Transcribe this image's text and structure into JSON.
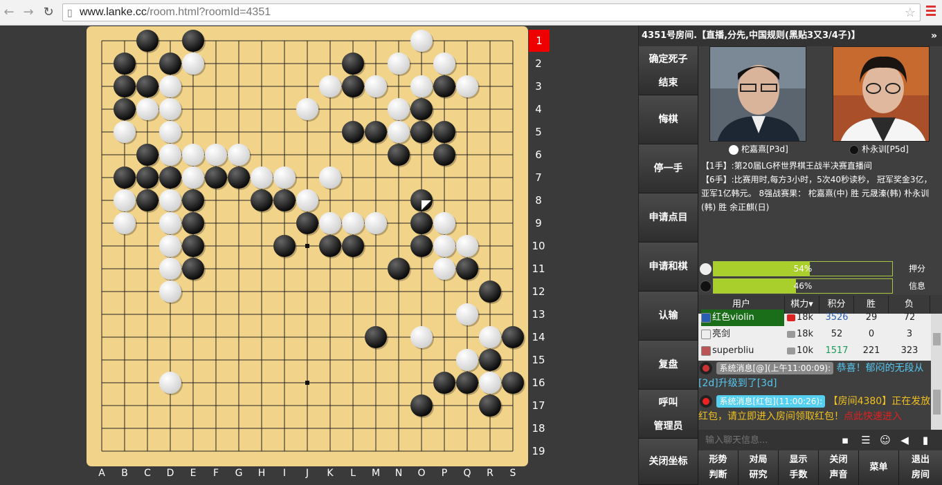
{
  "browser": {
    "url_host": "www.lanke.cc",
    "url_path": "/room.html?roomId=4351"
  },
  "board": {
    "size": 19,
    "columns": [
      "A",
      "B",
      "C",
      "D",
      "E",
      "F",
      "G",
      "H",
      "I",
      "J",
      "K",
      "L",
      "M",
      "N",
      "O",
      "P",
      "Q",
      "R",
      "S"
    ],
    "rows": [
      "1",
      "2",
      "3",
      "4",
      "5",
      "6",
      "7",
      "8",
      "9",
      "10",
      "11",
      "12",
      "13",
      "14",
      "15",
      "16",
      "17",
      "18",
      "19"
    ],
    "highlighted_row": "1",
    "stones": [
      {
        "c": "black",
        "x": 3,
        "y": 1
      },
      {
        "c": "black",
        "x": 5,
        "y": 1
      },
      {
        "c": "white",
        "x": 15,
        "y": 1
      },
      {
        "c": "black",
        "x": 2,
        "y": 2
      },
      {
        "c": "black",
        "x": 4,
        "y": 2
      },
      {
        "c": "white",
        "x": 5,
        "y": 2
      },
      {
        "c": "black",
        "x": 12,
        "y": 2
      },
      {
        "c": "white",
        "x": 14,
        "y": 2
      },
      {
        "c": "white",
        "x": 16,
        "y": 2
      },
      {
        "c": "black",
        "x": 2,
        "y": 3
      },
      {
        "c": "black",
        "x": 3,
        "y": 3
      },
      {
        "c": "white",
        "x": 4,
        "y": 3
      },
      {
        "c": "white",
        "x": 11,
        "y": 3
      },
      {
        "c": "black",
        "x": 12,
        "y": 3
      },
      {
        "c": "white",
        "x": 13,
        "y": 3
      },
      {
        "c": "white",
        "x": 15,
        "y": 3
      },
      {
        "c": "black",
        "x": 16,
        "y": 3
      },
      {
        "c": "white",
        "x": 17,
        "y": 3
      },
      {
        "c": "black",
        "x": 2,
        "y": 4
      },
      {
        "c": "white",
        "x": 3,
        "y": 4
      },
      {
        "c": "white",
        "x": 4,
        "y": 4
      },
      {
        "c": "white",
        "x": 10,
        "y": 4
      },
      {
        "c": "white",
        "x": 14,
        "y": 4
      },
      {
        "c": "black",
        "x": 15,
        "y": 4
      },
      {
        "c": "white",
        "x": 2,
        "y": 5
      },
      {
        "c": "white",
        "x": 4,
        "y": 5
      },
      {
        "c": "black",
        "x": 12,
        "y": 5
      },
      {
        "c": "black",
        "x": 13,
        "y": 5
      },
      {
        "c": "white",
        "x": 14,
        "y": 5
      },
      {
        "c": "black",
        "x": 15,
        "y": 5
      },
      {
        "c": "black",
        "x": 16,
        "y": 5
      },
      {
        "c": "black",
        "x": 3,
        "y": 6
      },
      {
        "c": "white",
        "x": 4,
        "y": 6
      },
      {
        "c": "white",
        "x": 5,
        "y": 6
      },
      {
        "c": "white",
        "x": 6,
        "y": 6
      },
      {
        "c": "white",
        "x": 7,
        "y": 6
      },
      {
        "c": "black",
        "x": 14,
        "y": 6
      },
      {
        "c": "black",
        "x": 16,
        "y": 6
      },
      {
        "c": "black",
        "x": 2,
        "y": 7
      },
      {
        "c": "black",
        "x": 3,
        "y": 7
      },
      {
        "c": "black",
        "x": 4,
        "y": 7
      },
      {
        "c": "white",
        "x": 5,
        "y": 7
      },
      {
        "c": "black",
        "x": 6,
        "y": 7
      },
      {
        "c": "black",
        "x": 7,
        "y": 7
      },
      {
        "c": "white",
        "x": 8,
        "y": 7
      },
      {
        "c": "white",
        "x": 9,
        "y": 7
      },
      {
        "c": "white",
        "x": 11,
        "y": 7
      },
      {
        "c": "white",
        "x": 2,
        "y": 8
      },
      {
        "c": "black",
        "x": 3,
        "y": 8
      },
      {
        "c": "white",
        "x": 4,
        "y": 8
      },
      {
        "c": "black",
        "x": 5,
        "y": 8
      },
      {
        "c": "black",
        "x": 8,
        "y": 8
      },
      {
        "c": "black",
        "x": 9,
        "y": 8
      },
      {
        "c": "white",
        "x": 10,
        "y": 8
      },
      {
        "c": "black",
        "x": 15,
        "y": 8,
        "last": true
      },
      {
        "c": "white",
        "x": 2,
        "y": 9
      },
      {
        "c": "white",
        "x": 4,
        "y": 9
      },
      {
        "c": "black",
        "x": 5,
        "y": 9
      },
      {
        "c": "black",
        "x": 10,
        "y": 9
      },
      {
        "c": "white",
        "x": 11,
        "y": 9
      },
      {
        "c": "white",
        "x": 12,
        "y": 9
      },
      {
        "c": "white",
        "x": 13,
        "y": 9
      },
      {
        "c": "black",
        "x": 15,
        "y": 9
      },
      {
        "c": "white",
        "x": 16,
        "y": 9
      },
      {
        "c": "white",
        "x": 4,
        "y": 10
      },
      {
        "c": "black",
        "x": 5,
        "y": 10
      },
      {
        "c": "black",
        "x": 9,
        "y": 10
      },
      {
        "c": "black",
        "x": 11,
        "y": 10
      },
      {
        "c": "black",
        "x": 12,
        "y": 10
      },
      {
        "c": "black",
        "x": 15,
        "y": 10
      },
      {
        "c": "white",
        "x": 16,
        "y": 10
      },
      {
        "c": "white",
        "x": 17,
        "y": 10
      },
      {
        "c": "white",
        "x": 4,
        "y": 11
      },
      {
        "c": "black",
        "x": 5,
        "y": 11
      },
      {
        "c": "black",
        "x": 14,
        "y": 11
      },
      {
        "c": "white",
        "x": 16,
        "y": 11
      },
      {
        "c": "black",
        "x": 17,
        "y": 11
      },
      {
        "c": "white",
        "x": 4,
        "y": 12
      },
      {
        "c": "black",
        "x": 18,
        "y": 12
      },
      {
        "c": "white",
        "x": 17,
        "y": 13
      },
      {
        "c": "black",
        "x": 13,
        "y": 14
      },
      {
        "c": "white",
        "x": 15,
        "y": 14
      },
      {
        "c": "white",
        "x": 18,
        "y": 14
      },
      {
        "c": "black",
        "x": 19,
        "y": 14
      },
      {
        "c": "white",
        "x": 17,
        "y": 15
      },
      {
        "c": "black",
        "x": 18,
        "y": 15
      },
      {
        "c": "white",
        "x": 4,
        "y": 16
      },
      {
        "c": "black",
        "x": 16,
        "y": 16
      },
      {
        "c": "black",
        "x": 17,
        "y": 16
      },
      {
        "c": "white",
        "x": 18,
        "y": 16
      },
      {
        "c": "black",
        "x": 19,
        "y": 16
      },
      {
        "c": "black",
        "x": 15,
        "y": 17
      },
      {
        "c": "black",
        "x": 18,
        "y": 17
      }
    ],
    "star_points": [
      {
        "x": 10,
        "y": 10
      },
      {
        "x": 10,
        "y": 16
      }
    ]
  },
  "room": {
    "title": "4351号房间.【直播,分先,中国规则(黑贴3又3/4子)】",
    "expand": "»"
  },
  "side_buttons": [
    {
      "lines": [
        "确定死子",
        "结束"
      ]
    },
    {
      "lines": [
        "悔棋"
      ]
    },
    {
      "lines": [
        "停一手"
      ]
    },
    {
      "lines": [
        "申请点目"
      ]
    },
    {
      "lines": [
        "申请和棋"
      ]
    },
    {
      "lines": [
        "认输"
      ]
    },
    {
      "lines": [
        "复盘"
      ]
    },
    {
      "lines": [
        "呼叫",
        "管理员"
      ]
    },
    {
      "lines": [
        "关闭坐标"
      ]
    }
  ],
  "players": {
    "white": {
      "name": "柁嘉熹[P3d]"
    },
    "black": {
      "name": "朴永训[P5d]"
    }
  },
  "info": {
    "line1": "【1手】:第20届LG杯世界棋王战半决赛直播间",
    "line2": "【6手】:比赛用时,每方3小时，5次40秒读秒， 冠军奖金3亿，亚军1亿韩元。 8强战赛果： 柁嘉熹(中) 胜 元晟溱(韩) 朴永训(韩) 胜 余正麒(日)"
  },
  "meter": {
    "white": {
      "value": 54,
      "label": "54%"
    },
    "black": {
      "value": 46,
      "label": "46%"
    },
    "btn1": "押分",
    "btn2": "信息"
  },
  "users": {
    "headers": [
      "用户",
      "棋力▾",
      "积分",
      "胜",
      "负"
    ],
    "rows": [
      {
        "name": "红色violin",
        "rank": "18k",
        "score": "3526",
        "win": "29",
        "lose": "72"
      },
      {
        "name": "亮剑",
        "rank": "18k",
        "score": "52",
        "win": "0",
        "lose": "3"
      },
      {
        "name": "superbliu",
        "rank": "10k",
        "score": "1517",
        "win": "221",
        "lose": "323"
      }
    ]
  },
  "chat": {
    "msg1_badge": "系统消息[@](上午11:00:09):",
    "msg1_text": "恭喜！郁闷的无段从[2d]升级到了[3d]",
    "msg2_badge": "系统消息[红包](11:00:26):",
    "msg2_text_a": "【房间4380】正在发放红包，请立即进入房间领取红包！",
    "msg2_text_b": "点此快速进入",
    "placeholder": "输入聊天信息..."
  },
  "bottom_buttons": [
    {
      "lines": [
        "形势",
        "判断"
      ]
    },
    {
      "lines": [
        "对局",
        "研究"
      ]
    },
    {
      "lines": [
        "显示",
        "手数"
      ]
    },
    {
      "lines": [
        "关闭",
        "声音"
      ]
    },
    {
      "lines": [
        "菜单"
      ]
    },
    {
      "lines": [
        "退出",
        "房间"
      ]
    }
  ]
}
